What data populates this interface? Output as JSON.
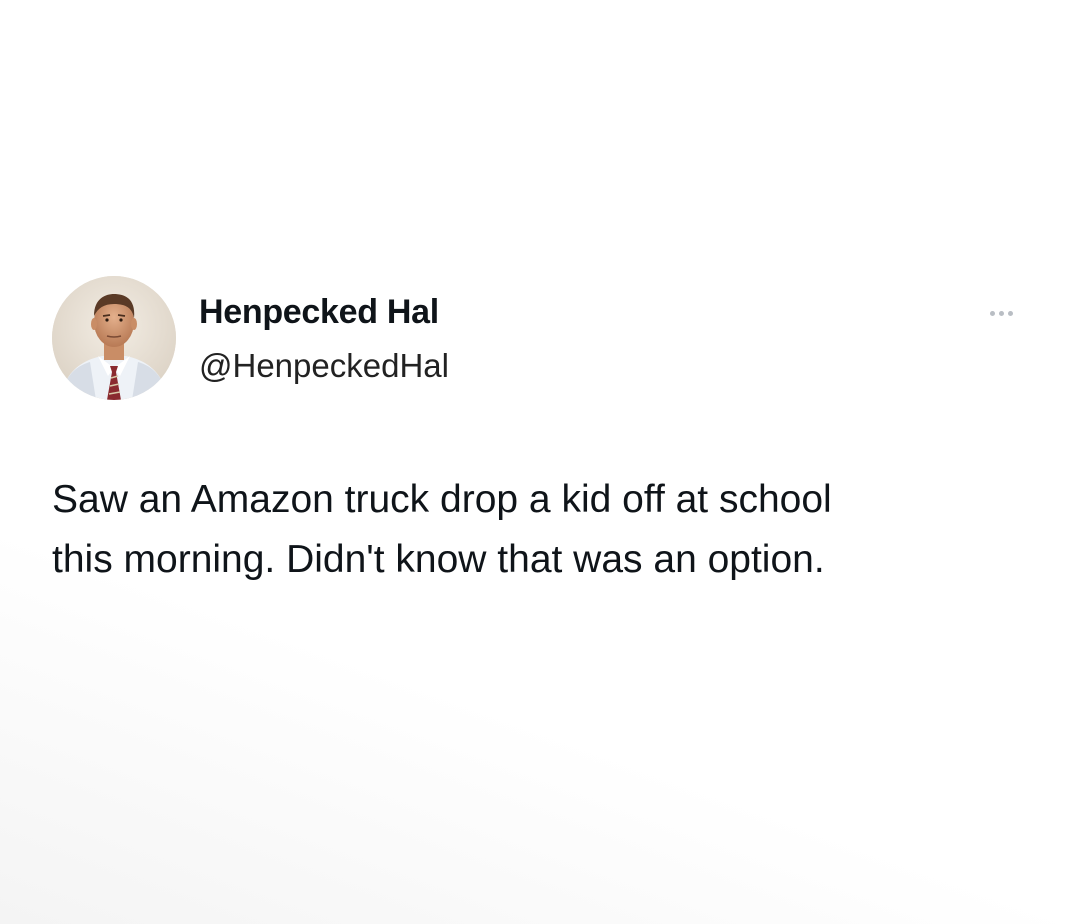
{
  "tweet": {
    "author": {
      "display_name": "Henpecked Hal",
      "handle": "@HenpeckedHal",
      "avatar_icon": "profile-photo"
    },
    "text_line1": "Saw an Amazon truck drop a kid off at school",
    "text_line2": "this morning. Didn't know that was an option.",
    "more_icon": "ellipsis-icon"
  },
  "colors": {
    "background": "#ffffff",
    "text": "#0f1419",
    "more_dots": "#b9bec4"
  }
}
